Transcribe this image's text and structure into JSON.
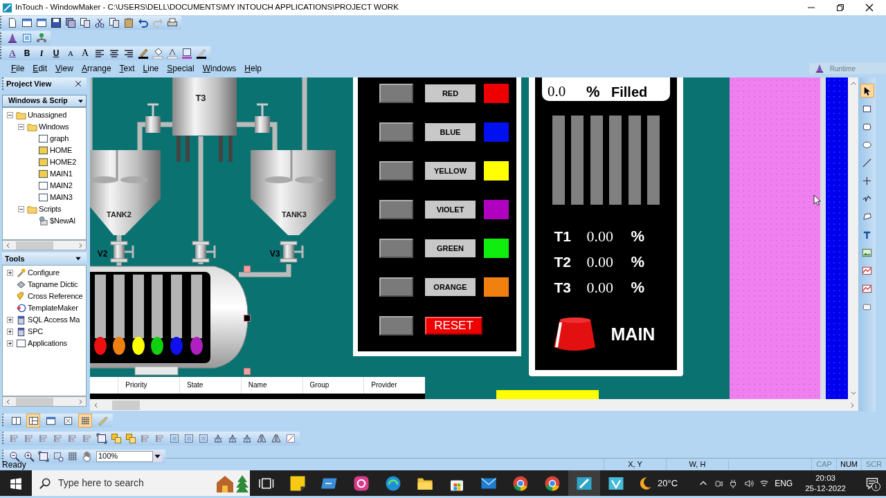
{
  "window": {
    "title": "InTouch - WindowMaker - C:\\USERS\\DELL\\DOCUMENTS\\MY INTOUCH APPLICATIONS\\PROJECT WORK"
  },
  "format_toolbar": [
    {
      "kind": "font",
      "label": "A"
    },
    {
      "kind": "bold",
      "label": "B"
    },
    {
      "kind": "italic",
      "label": "I"
    },
    {
      "kind": "underline",
      "label": "U"
    },
    {
      "kind": "smaller",
      "label": "A"
    },
    {
      "kind": "larger",
      "label": "A"
    }
  ],
  "menu": [
    "File",
    "Edit",
    "View",
    "Arrange",
    "Text",
    "Line",
    "Special",
    "Windows",
    "Help"
  ],
  "runtime_button": {
    "label": "Runtime"
  },
  "project_view": {
    "title": "Project View",
    "section": "Windows & Scrip",
    "tree": [
      {
        "label": "Unassigned",
        "kind": "folder",
        "expanded": true,
        "children": [
          {
            "label": "Windows",
            "kind": "folder",
            "expanded": true,
            "children": [
              {
                "label": "graph",
                "kind": "window",
                "open": false
              },
              {
                "label": "HOME",
                "kind": "window",
                "open": true
              },
              {
                "label": "HOME2",
                "kind": "window",
                "open": true
              },
              {
                "label": "MAIN1",
                "kind": "window",
                "open": true
              },
              {
                "label": "MAIN2",
                "kind": "window",
                "open": false
              },
              {
                "label": "MAIN3",
                "kind": "window",
                "open": false
              }
            ]
          },
          {
            "label": "Scripts",
            "kind": "folder",
            "expanded": true,
            "children": [
              {
                "label": "$NewAl",
                "kind": "script"
              }
            ]
          }
        ]
      }
    ]
  },
  "tools": {
    "title": "Tools",
    "items": [
      {
        "label": "Configure",
        "kind": "wrench",
        "expanded": false
      },
      {
        "label": "Tagname Dictic",
        "kind": "dictionary"
      },
      {
        "label": "Cross Reference",
        "kind": "tag"
      },
      {
        "label": "TemplateMaker",
        "kind": "template"
      },
      {
        "label": "SQL Access Ma",
        "kind": "database",
        "expanded": false
      },
      {
        "label": "SPC",
        "kind": "database",
        "expanded": false
      },
      {
        "label": "Applications",
        "kind": "window",
        "expanded": false
      }
    ]
  },
  "canvas": {
    "process": {
      "labels": [
        {
          "kind": "tank",
          "text": "T3"
        },
        {
          "kind": "tank",
          "text": "TANK2"
        },
        {
          "kind": "tank",
          "text": "TANK3"
        },
        {
          "kind": "valve",
          "text": "V2"
        },
        {
          "kind": "valve",
          "text": "V3"
        }
      ]
    },
    "color_panel": {
      "rows": [
        {
          "label": "RED",
          "color": "#ee0000"
        },
        {
          "label": "BLUE",
          "color": "#0010ee"
        },
        {
          "label": "YELLOW",
          "color": "#ffff00"
        },
        {
          "label": "VIOLET",
          "color": "#b000c0"
        },
        {
          "label": "GREEN",
          "color": "#10ee10"
        },
        {
          "label": "ORANGE",
          "color": "#f08010"
        }
      ],
      "reset": {
        "label": "RESET"
      }
    },
    "fill_panel": {
      "value": "0.0",
      "unit": "%",
      "caption": "Filled",
      "readings": [
        {
          "tag": "T1",
          "value": "0.00",
          "unit": "%"
        },
        {
          "tag": "T2",
          "value": "0.00",
          "unit": "%"
        },
        {
          "tag": "T3",
          "value": "0.00",
          "unit": "%"
        }
      ],
      "button": {
        "label": "MAIN"
      }
    },
    "alarm_table": {
      "columns": [
        "Priority",
        "State",
        "Name",
        "Group",
        "Provider"
      ]
    }
  },
  "toolbox": [
    {
      "kind": "pointer",
      "selected": true
    },
    {
      "kind": "rectangle",
      "selected": false
    },
    {
      "kind": "rounded",
      "selected": false
    },
    {
      "kind": "ellipse",
      "selected": false
    },
    {
      "kind": "line",
      "selected": false
    },
    {
      "kind": "cross",
      "selected": false
    },
    {
      "kind": "polyline",
      "selected": false
    },
    {
      "kind": "polygon",
      "selected": false
    },
    {
      "kind": "text",
      "selected": false
    },
    {
      "kind": "picture",
      "selected": false
    },
    {
      "kind": "chart",
      "selected": false
    },
    {
      "kind": "chart",
      "selected": false
    },
    {
      "kind": "button",
      "selected": false
    }
  ],
  "view_toggles": [
    {
      "kind": "split",
      "selected": false
    },
    {
      "kind": "panes",
      "selected": true
    },
    {
      "kind": "window",
      "selected": false
    },
    {
      "kind": "fullscreen",
      "selected": false
    },
    {
      "kind": "grid",
      "selected": true
    },
    {
      "kind": "ruler",
      "selected": false
    }
  ],
  "zoom": {
    "value": "100%"
  },
  "status_bar": {
    "message": "Ready",
    "fields": [
      "X, Y",
      "W, H"
    ],
    "indicators": [
      {
        "text": "CAP",
        "disabled": true
      },
      {
        "text": "NUM",
        "disabled": false
      },
      {
        "text": "SCR",
        "disabled": true
      }
    ]
  },
  "taskbar": {
    "search": {
      "placeholder": "Type here to search"
    },
    "apps": [
      {
        "kind": "taskview",
        "active": false
      },
      {
        "kind": "note",
        "active": false
      },
      {
        "kind": "board",
        "active": false
      },
      {
        "kind": "camera",
        "active": false
      },
      {
        "kind": "browser",
        "active": false
      },
      {
        "kind": "folder",
        "active": false
      },
      {
        "kind": "bag",
        "active": false
      },
      {
        "kind": "mail",
        "active": false
      },
      {
        "kind": "chrome",
        "active": false
      },
      {
        "kind": "chrome",
        "active": false
      },
      {
        "kind": "app",
        "active": true
      },
      {
        "kind": "viewer",
        "active": false
      }
    ],
    "temperature": "20°C",
    "language": "ENG",
    "time": "20:03",
    "date": "25-12-2022",
    "notifications": "1"
  }
}
